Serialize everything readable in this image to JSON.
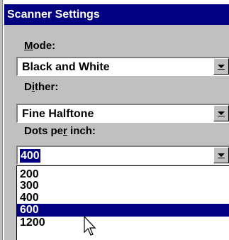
{
  "window": {
    "title": "Scanner Settings"
  },
  "mode": {
    "label_underlined": "M",
    "label_rest": "ode:",
    "value": "Black and White"
  },
  "dither": {
    "label_pre": "D",
    "label_underlined": "i",
    "label_rest": "ther:",
    "value": "Fine Halftone"
  },
  "dpi": {
    "label_pre": "Dots pe",
    "label_underlined": "r",
    "label_rest": " inch:",
    "value": "400",
    "options": [
      "200",
      "300",
      "400",
      "600",
      "1200"
    ],
    "highlighted_option": "600"
  },
  "colors": {
    "titlebar": "#000080",
    "face": "#c0c0c0",
    "highlight": "#000080"
  },
  "icons": {
    "dropdown": "chevron-down-icon",
    "cursor": "mouse-pointer-icon"
  }
}
